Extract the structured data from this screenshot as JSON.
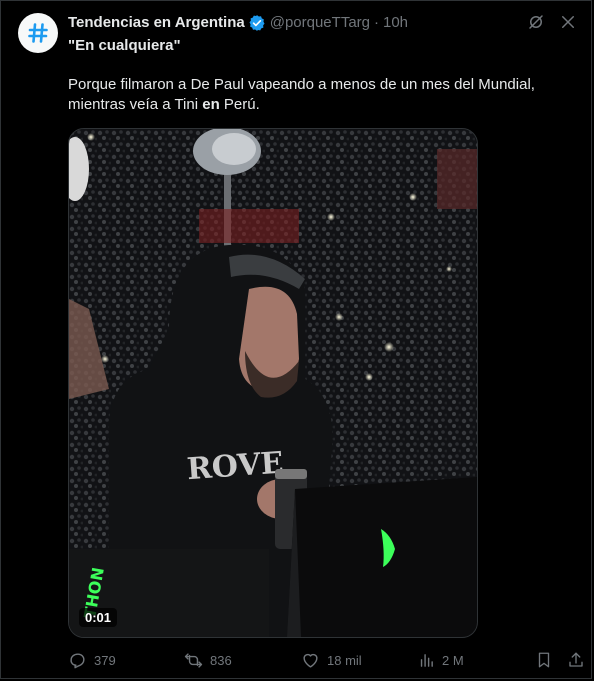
{
  "account": {
    "name": "Tendencias en Argentina",
    "handle": "@porqueTTarg",
    "separator": "·",
    "time": "10h",
    "avatar_icon": "hashtag-icon",
    "verified_color": "#1d9bf0"
  },
  "post": {
    "tagline": "\"En cualquiera\"",
    "text_part1": "Porque filmaron a De Paul vapeando a menos de un mes del Mundial, mientras veía a Tini ",
    "text_bold": "en",
    "text_part2": " Perú."
  },
  "media": {
    "timestamp": "0:01"
  },
  "actions": {
    "replies": "379",
    "reposts": "836",
    "likes": "18 mil",
    "views": "2 M"
  },
  "colors": {
    "background": "#000000",
    "text": "#e7e9ea",
    "muted": "#71767b",
    "accent": "#1d9bf0"
  }
}
